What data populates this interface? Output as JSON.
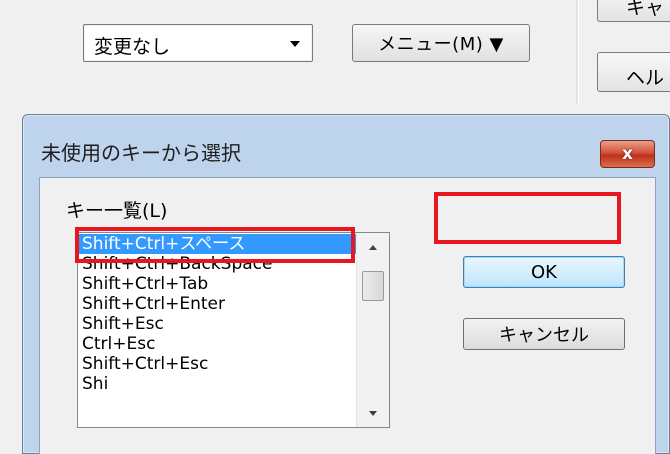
{
  "background_window": {
    "combo_value": "変更なし",
    "menu_button_label": "メニュー(M) ▼",
    "partial_top_button_label": "キャ",
    "partial_help_button_label": "ヘル"
  },
  "dialog": {
    "title": "未使用のキーから選択",
    "close_label": "x",
    "list_label": "キー一覧(L)",
    "items": [
      "Shift+Ctrl+スペース",
      "Shift+Ctrl+BackSpace",
      "Shift+Ctrl+Tab",
      "Shift+Ctrl+Enter",
      "Shift+Esc",
      "Ctrl+Esc",
      "Shift+Ctrl+Esc",
      "Shi"
    ],
    "selected_index": 0,
    "ok_label": "OK",
    "cancel_label": "キャンセル"
  },
  "colors": {
    "selection": "#3399ff",
    "highlight_annotation": "#e8161e",
    "dialog_frame": "#bed3ec"
  }
}
